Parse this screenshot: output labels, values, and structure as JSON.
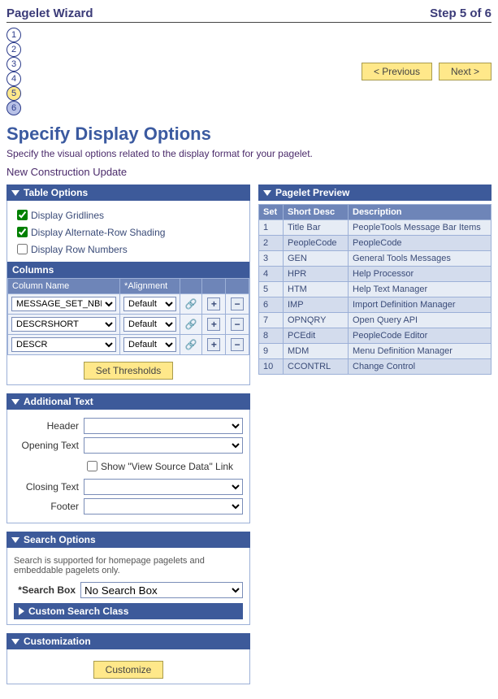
{
  "header": {
    "title": "Pagelet Wizard",
    "step_text": "Step 5 of 6"
  },
  "wizard": {
    "steps": [
      "1",
      "2",
      "3",
      "4",
      "5",
      "6"
    ],
    "active_index": 4
  },
  "nav": {
    "prev": "< Previous",
    "next": "Next >"
  },
  "page": {
    "title": "Specify Display Options",
    "desc": "Specify the visual options related to the display format for your pagelet.",
    "subtitle": "New Construction Update"
  },
  "table_options": {
    "heading": "Table Options",
    "chk_gridlines": "Display Gridlines",
    "chk_altrow": "Display Alternate-Row Shading",
    "chk_rownum": "Display Row Numbers",
    "columns_heading": "Columns",
    "col_name_hdr": "Column Name",
    "col_align_hdr": "*Alignment",
    "rows": [
      {
        "name": "MESSAGE_SET_NBR",
        "align": "Default"
      },
      {
        "name": "DESCRSHORT",
        "align": "Default"
      },
      {
        "name": "DESCR",
        "align": "Default"
      }
    ],
    "set_thresholds": "Set Thresholds"
  },
  "additional_text": {
    "heading": "Additional Text",
    "header_lbl": "Header",
    "opening_lbl": "Opening Text",
    "show_view_source": "Show \"View Source Data\" Link",
    "closing_lbl": "Closing Text",
    "footer_lbl": "Footer"
  },
  "search_options": {
    "heading": "Search Options",
    "note": "Search is supported for homepage pagelets and embeddable pagelets only.",
    "searchbox_lbl": "*Search Box",
    "searchbox_val": "No Search Box",
    "custom_class": "Custom Search Class"
  },
  "customization": {
    "heading": "Customization",
    "button": "Customize"
  },
  "preview": {
    "heading": "Pagelet Preview",
    "cols": {
      "set": "Set",
      "short": "Short Desc",
      "desc": "Description"
    },
    "chart_data": {
      "type": "table",
      "columns": [
        "Set",
        "Short Desc",
        "Description"
      ],
      "rows": [
        {
          "set": "1",
          "short": "Title Bar",
          "desc": "PeopleTools Message Bar Items"
        },
        {
          "set": "2",
          "short": "PeopleCode",
          "desc": "PeopleCode"
        },
        {
          "set": "3",
          "short": "GEN",
          "desc": "General Tools Messages"
        },
        {
          "set": "4",
          "short": "HPR",
          "desc": "Help Processor"
        },
        {
          "set": "5",
          "short": "HTM",
          "desc": "Help Text Manager"
        },
        {
          "set": "6",
          "short": "IMP",
          "desc": "Import Definition Manager"
        },
        {
          "set": "7",
          "short": "OPNQRY",
          "desc": "Open Query API"
        },
        {
          "set": "8",
          "short": "PCEdit",
          "desc": "PeopleCode Editor"
        },
        {
          "set": "9",
          "short": "MDM",
          "desc": "Menu Definition Manager"
        },
        {
          "set": "10",
          "short": "CCONTRL",
          "desc": "Change Control"
        }
      ]
    }
  }
}
